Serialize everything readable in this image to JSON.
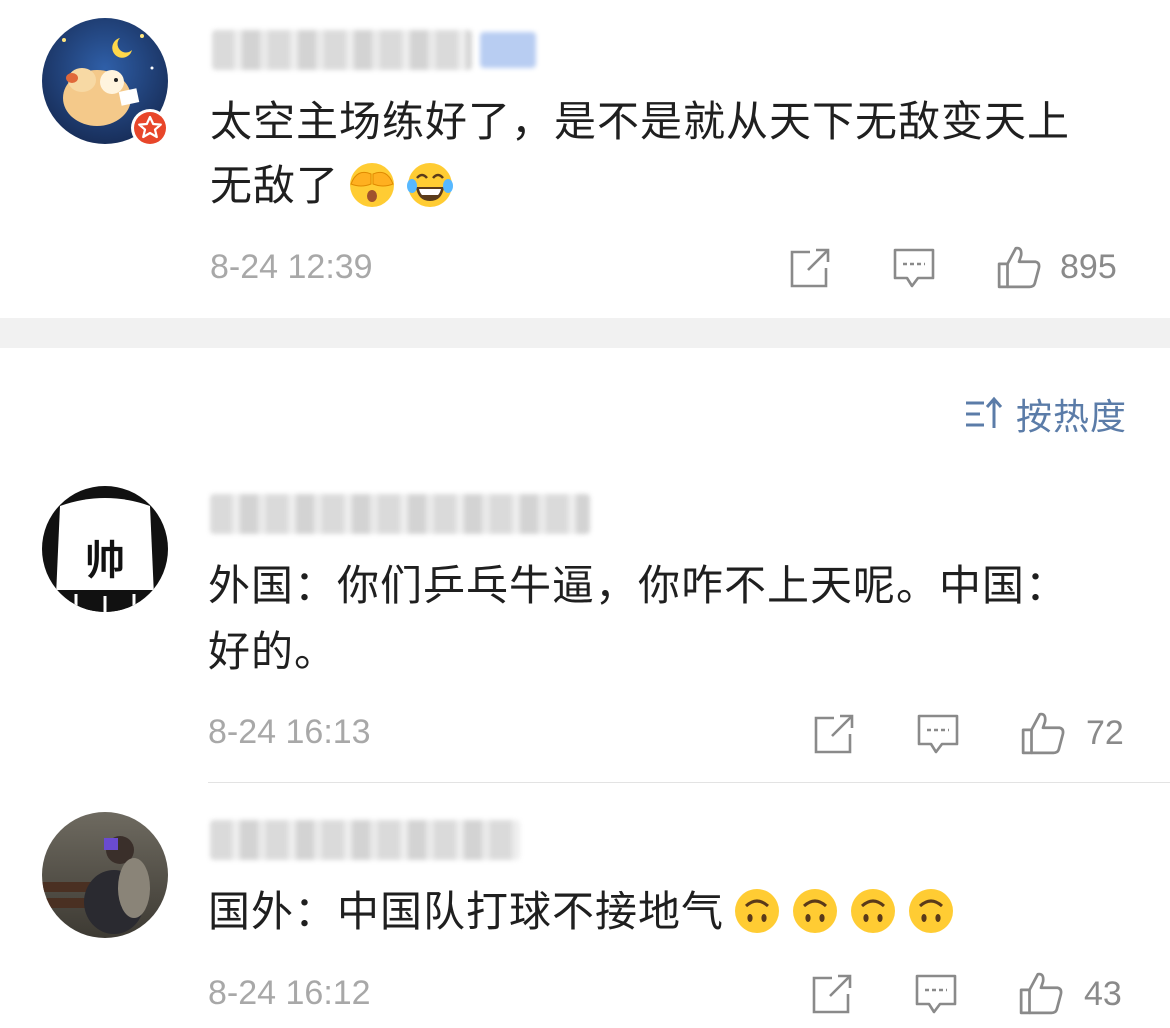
{
  "top_comment": {
    "text_line1": "太空主场练好了，是不是就从天下无敌变天上",
    "text_line2": "无敌了",
    "emojis": [
      "hands-over-eyes-emoji",
      "laughing-tears-emoji"
    ],
    "time": "8-24 12:39",
    "likes": "895"
  },
  "sort": {
    "label": "按热度",
    "icon": "sort-icon"
  },
  "comments": [
    {
      "avatar_text": "帅",
      "text_line1": "外国：你们乒乓牛逼，你咋不上天呢。中国：",
      "text_line2": "好的。",
      "time": "8-24 16:13",
      "likes": "72"
    },
    {
      "text_line1": "国外：中国队打球不接地气",
      "emojis": [
        "upside-down-face-emoji",
        "upside-down-face-emoji",
        "upside-down-face-emoji",
        "upside-down-face-emoji"
      ],
      "time": "8-24 16:12",
      "likes": "43"
    }
  ],
  "colors": {
    "accent": "#5b7ca8",
    "muted": "#a8a8a8",
    "badge": "#e8462a"
  }
}
